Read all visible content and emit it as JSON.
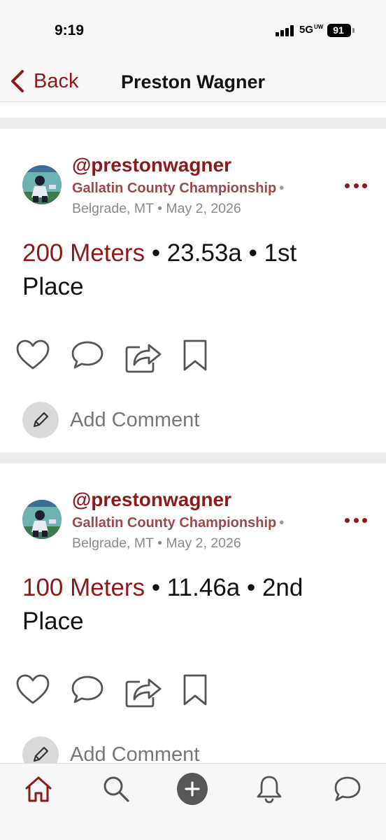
{
  "status_bar": {
    "time": "9:19",
    "network": "5G",
    "network_sup": "UW",
    "battery": "91"
  },
  "nav": {
    "back_label": "Back",
    "title": "Preston Wagner",
    "back_icon": "chevron-left-icon"
  },
  "posts": [
    {
      "username": "@prestonwagner",
      "meet": "Gallatin County Championship",
      "separator": "•",
      "location_date": "Belgrade, MT • May 2, 2026",
      "event": "200 Meters",
      "result_detail": " • 23.53a • 1st Place",
      "comment_label": "Add Comment"
    },
    {
      "username": "@prestonwagner",
      "meet": "Gallatin County Championship",
      "separator": "•",
      "location_date": "Belgrade, MT • May 2, 2026",
      "event": "100 Meters",
      "result_detail": " • 11.46a • 2nd Place",
      "comment_label": "Add Comment"
    }
  ],
  "tabs": [
    "home-icon",
    "search-icon",
    "add-icon",
    "bell-icon",
    "messages-icon"
  ],
  "colors": {
    "accent": "#8b1a1a",
    "meet": "#9a4a4a",
    "muted": "#8a8a8a",
    "bar_bg": "#f7f7f7",
    "divider": "#ececec"
  }
}
